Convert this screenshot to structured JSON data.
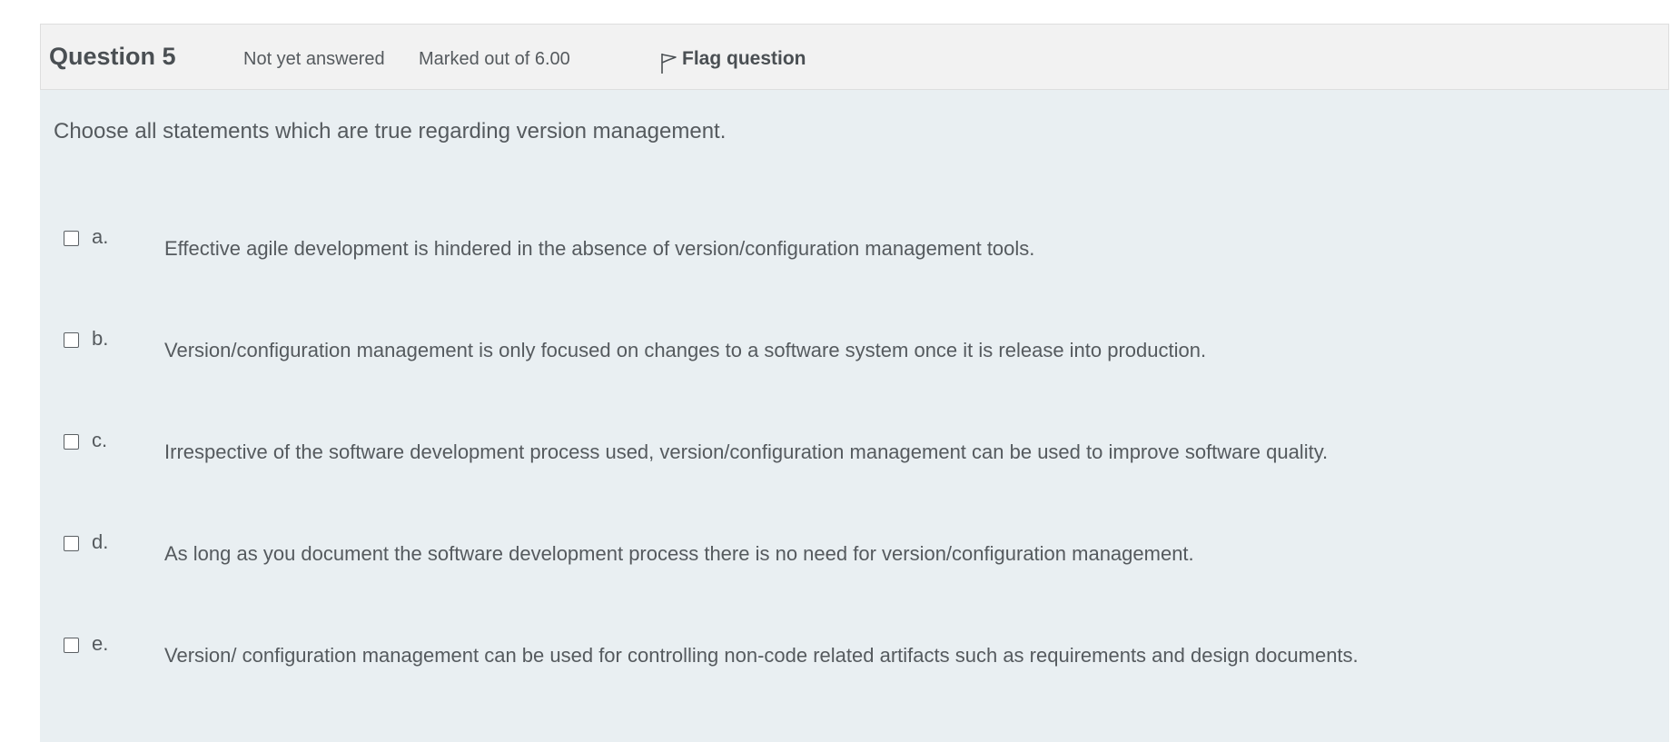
{
  "question": {
    "title": "Question 5",
    "state": "Not yet answered",
    "grade": "Marked out of 6.00",
    "flag_label": "Flag question",
    "flag_icon": "flag-icon",
    "text": "Choose all statements which are true regarding version management."
  },
  "options": [
    {
      "letter": "a.",
      "text": "Effective agile development is hindered in the absence of version/configuration management tools.",
      "checked": false
    },
    {
      "letter": "b.",
      "text": "Version/configuration management is only focused on changes to a software system once it is release into production.",
      "checked": false
    },
    {
      "letter": "c.",
      "text": "Irrespective of the software development process used, version/configuration management can be used to improve software quality.",
      "checked": false
    },
    {
      "letter": "d.",
      "text": "As long as you document the software development process there is no need for version/configuration management.",
      "checked": false
    },
    {
      "letter": "e.",
      "text": "Version/ configuration management can be used for controlling non-code related artifacts such as requirements and design documents.",
      "checked": false
    }
  ],
  "colors": {
    "info_bar_bg": "#f2f2f2",
    "content_bg": "#e9eff2",
    "text": "#4a4f53"
  }
}
